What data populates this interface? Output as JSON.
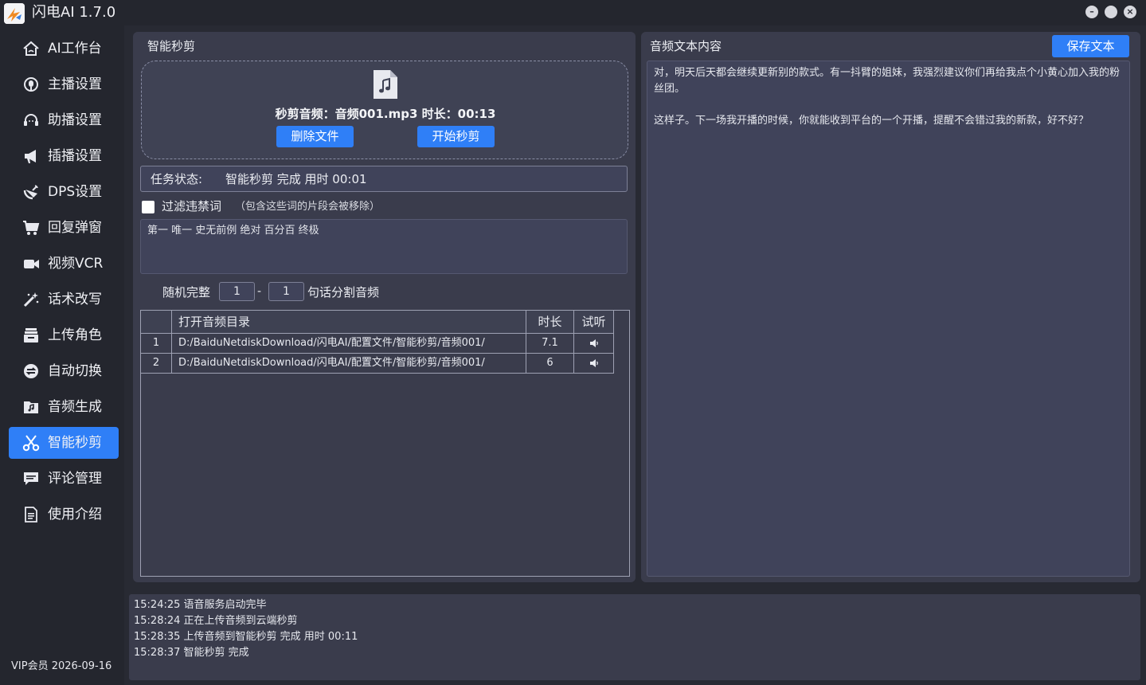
{
  "window": {
    "title": "闪电AI 1.7.0",
    "logo_icon": "app-logo-icon"
  },
  "sidebar": {
    "active_color": "#2f7ff7",
    "items": [
      {
        "label": "AI工作台",
        "icon": "home-icon"
      },
      {
        "label": "主播设置",
        "icon": "anchor-icon"
      },
      {
        "label": "助播设置",
        "icon": "headset-icon"
      },
      {
        "label": "插播设置",
        "icon": "megaphone-icon"
      },
      {
        "label": "DPS设置",
        "icon": "satellite-icon"
      },
      {
        "label": "回复弹窗",
        "icon": "cart-icon"
      },
      {
        "label": "视频VCR",
        "icon": "video-camera-icon"
      },
      {
        "label": "话术改写",
        "icon": "magic-wand-icon"
      },
      {
        "label": "上传角色",
        "icon": "box-icon"
      },
      {
        "label": "自动切换",
        "icon": "switch-icon"
      },
      {
        "label": "音频生成",
        "icon": "music-folder-icon"
      },
      {
        "label": "智能秒剪",
        "icon": "scissors-icon"
      },
      {
        "label": "评论管理",
        "icon": "comment-icon"
      },
      {
        "label": "使用介绍",
        "icon": "document-icon"
      }
    ],
    "active_index": 11,
    "vip_text": "VIP会员  2026-09-16"
  },
  "left_panel": {
    "title": "智能秒剪",
    "file_info": "秒剪音频：音频001.mp3 时长：00:13",
    "delete_button": "删除文件",
    "start_button": "开始秒剪",
    "status_label": "任务状态:",
    "status_value": "智能秒剪 完成 用时 00:01",
    "filter_label": "过滤违禁词",
    "filter_hint": "（包含这些词的片段会被移除）",
    "filter_checked": false,
    "banned_words": "第一 唯一 史无前例 绝对 百分百 终极",
    "random_label": "随机完整",
    "range_min": "1",
    "range_dash": "-",
    "range_max": "1",
    "split_label": "句话分割音频",
    "table": {
      "headers": [
        "",
        "打开音频目录",
        "时长",
        "试听"
      ],
      "rows": [
        {
          "num": "1",
          "path": "D:/BaiduNetdiskDownload/闪电AI/配置文件/智能秒剪/音频001/",
          "duration": "7.1",
          "play_icon": "speaker-icon"
        },
        {
          "num": "2",
          "path": "D:/BaiduNetdiskDownload/闪电AI/配置文件/智能秒剪/音频001/",
          "duration": "6",
          "play_icon": "speaker-icon"
        }
      ]
    }
  },
  "right_panel": {
    "title": "音频文本内容",
    "save_button": "保存文本",
    "paragraphs": [
      "对，明天后天都会继续更新别的款式。有一抖臂的姐妹，我强烈建议你们再给我点个小黄心加入我的粉丝团。",
      "这样子。下一场我开播的时候，你就能收到平台的一个开播，提醒不会错过我的新款，好不好？"
    ]
  },
  "log": [
    "15:24:25 语音服务启动完毕",
    "15:28:24 正在上传音频到云端秒剪",
    "15:28:35 上传音频到智能秒剪 完成 用时 00:11",
    "15:28:37 智能秒剪 完成"
  ]
}
